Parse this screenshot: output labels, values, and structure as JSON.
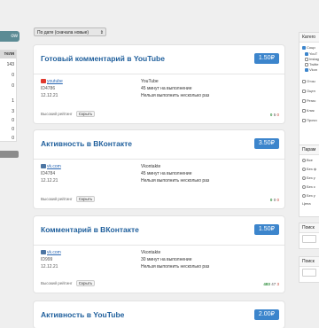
{
  "sidebar_left": {
    "button_label": "ow",
    "panel_header": "теля",
    "numbers": [
      "143",
      "0",
      "0",
      "1",
      "3",
      "0",
      "0",
      "0"
    ]
  },
  "sort": {
    "selected": "По дате (сначала новые)",
    "arrow": "⇕"
  },
  "tasks": [
    {
      "title": "Готовый комментарий в YouTube",
      "price": "1.50₽",
      "platform_link": "youtube",
      "id": "ID4786",
      "date": "12.12.21",
      "service": "YouTube",
      "duration": "45 минут на выполнение",
      "repeat": "Нельзя выполнить несколько раз",
      "rating": "Высокий рейтинг",
      "hide": "Скрыть",
      "stats": [
        "0",
        "5",
        "0"
      ]
    },
    {
      "title": "Активность в ВКонтакте",
      "price": "3.50₽",
      "platform_link": "vk.com",
      "id": "ID4784",
      "date": "12.12.21",
      "service": "Vkontakte",
      "duration": "45 минут на выполнение",
      "repeat": "Нельзя выполнить несколько раз",
      "rating": "Высокий рейтинг",
      "hide": "Скрыть",
      "stats": [
        "0",
        "0",
        "0"
      ]
    },
    {
      "title": "Комментарий в ВКонтакте",
      "price": "1.50₽",
      "platform_link": "vk.com",
      "id": "ID999",
      "date": "12.12.21",
      "service": "Vkontakte",
      "duration": "30 минут на выполнение",
      "repeat": "Нельзя выполнить несколько раз",
      "rating": "Высокий рейтинг",
      "hide": "Скрыть",
      "stats": [
        "483",
        "47",
        "3"
      ]
    },
    {
      "title": "Активность в YouTube",
      "price": "2.00₽"
    }
  ],
  "filters": {
    "categories_header": "Катего",
    "categories": [
      "Соци",
      "YouT",
      "Instag",
      "Twitte",
      "Vkon"
    ],
    "types": [
      "Отзы",
      "Оцен",
      "Регис",
      "Клик",
      "Прочи"
    ],
    "params_header": "Парам",
    "params": [
      "Все",
      "Без ф",
      "Без у",
      "Без с",
      "Без у"
    ],
    "price_label": "Цена",
    "search_header": "Поиск",
    "search2_header": "Поиск"
  },
  "colors": {
    "accent": "#3c85cc",
    "title": "#1f5f9c",
    "youtube": "#e03a2f",
    "vk": "#4c75a3",
    "stat_positive": "#2f8e3c",
    "stat_negative": "#c23a2c"
  }
}
